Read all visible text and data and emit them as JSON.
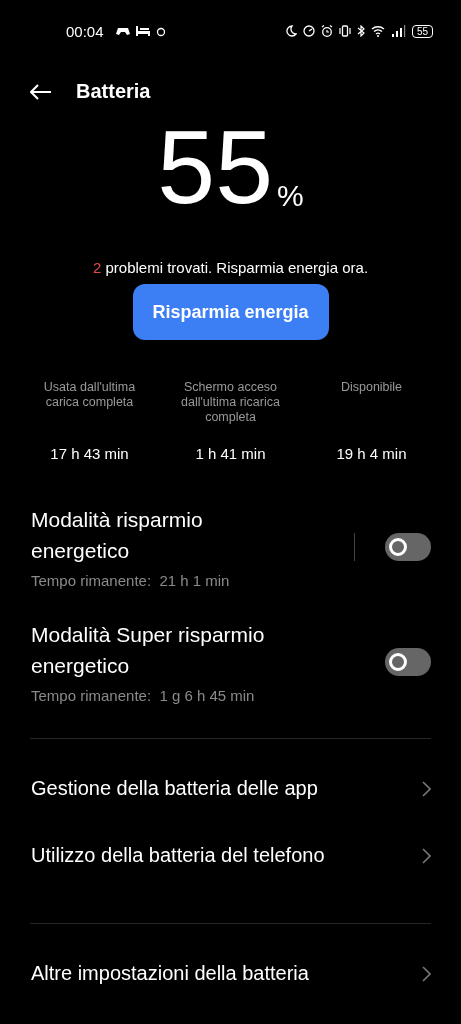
{
  "status_bar": {
    "time": "00:04",
    "battery": "55"
  },
  "header": {
    "title": "Batteria"
  },
  "level": {
    "value": "55",
    "unit": "%"
  },
  "warning": {
    "count": "2",
    "text": "problemi trovati. Risparmia energia ora."
  },
  "action_button": "Risparmia energia",
  "stats": [
    {
      "label": "Usata dall'ultima carica completa",
      "value": "17 h 43 min"
    },
    {
      "label": "Schermo acceso dall'ultima ricarica completa",
      "value": "1 h 41 min"
    },
    {
      "label": "Disponibile",
      "value": "19 h 4 min"
    }
  ],
  "modes": [
    {
      "title": "Modalità risparmio energetico",
      "subtitle": "Tempo rimanente:  21 h 1 min",
      "on": false,
      "separator": true
    },
    {
      "title": "Modalità Super risparmio energetico",
      "subtitle": "Tempo rimanente:  1 g 6 h 45 min",
      "on": false,
      "separator": false
    }
  ],
  "menu_groups": [
    [
      "Gestione della batteria delle app",
      "Utilizzo della batteria del telefono"
    ],
    [
      "Altre impostazioni della batteria"
    ]
  ]
}
